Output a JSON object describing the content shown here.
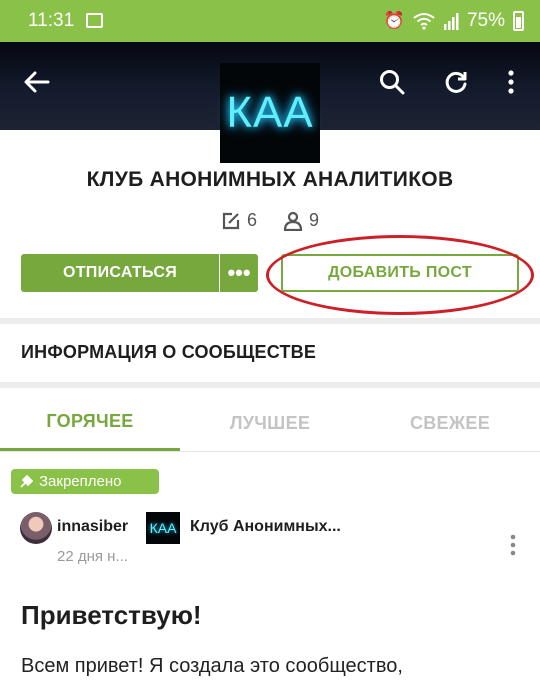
{
  "status_bar": {
    "time": "11:31",
    "battery": "75%",
    "color": "#8ac148"
  },
  "header": {
    "icons": [
      "back-arrow-icon",
      "search-icon",
      "refresh-icon",
      "more-vert-icon"
    ],
    "logo_text": "КАА"
  },
  "community": {
    "title": "КЛУБ АНОНИМНЫХ АНАЛИТИКОВ",
    "posts_count": "6",
    "members_count": "9",
    "unsubscribe_label": "ОТПИСАТЬСЯ",
    "more_label": "•••",
    "add_post_label": "ДОБАВИТЬ ПОСТ",
    "info_label": "ИНФОРМАЦИЯ О СООБЩЕСТВЕ"
  },
  "tabs": [
    {
      "label": "ГОРЯЧЕЕ",
      "active": true
    },
    {
      "label": "ЛУЧШЕЕ",
      "active": false
    },
    {
      "label": "СВЕЖЕЕ",
      "active": false
    }
  ],
  "post": {
    "pinned_label": "Закреплено",
    "author": "innasiber",
    "community_logo": "КАА",
    "community_name": "Клуб Анонимных...",
    "time": "22 дня н...",
    "title": "Приветствую!",
    "text": "Всем привет! Я создала это сообщество,"
  },
  "colors": {
    "accent": "#77a83e",
    "highlight": "#cc1f27"
  }
}
